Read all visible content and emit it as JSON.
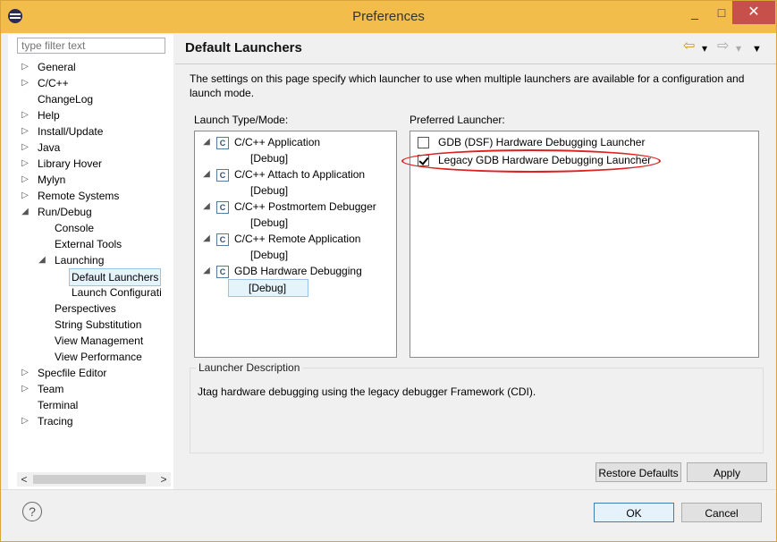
{
  "window": {
    "title": "Preferences",
    "min_label": "_",
    "max_label": "□",
    "close_label": "✕"
  },
  "left": {
    "filter_placeholder": "type filter text",
    "tree": [
      {
        "label": "General",
        "indent": 0,
        "twisty": "▷"
      },
      {
        "label": "C/C++",
        "indent": 0,
        "twisty": "▷"
      },
      {
        "label": "ChangeLog",
        "indent": 0,
        "twisty": ""
      },
      {
        "label": "Help",
        "indent": 0,
        "twisty": "▷"
      },
      {
        "label": "Install/Update",
        "indent": 0,
        "twisty": "▷"
      },
      {
        "label": "Java",
        "indent": 0,
        "twisty": "▷"
      },
      {
        "label": "Library Hover",
        "indent": 0,
        "twisty": "▷"
      },
      {
        "label": "Mylyn",
        "indent": 0,
        "twisty": "▷"
      },
      {
        "label": "Remote Systems",
        "indent": 0,
        "twisty": "▷"
      },
      {
        "label": "Run/Debug",
        "indent": 0,
        "twisty": "◢"
      },
      {
        "label": "Console",
        "indent": 1,
        "twisty": ""
      },
      {
        "label": "External Tools",
        "indent": 1,
        "twisty": ""
      },
      {
        "label": "Launching",
        "indent": 1,
        "twisty": "◢"
      },
      {
        "label": "Default Launchers",
        "indent": 2,
        "twisty": "",
        "selected": true
      },
      {
        "label": "Launch Configurati",
        "indent": 2,
        "twisty": ""
      },
      {
        "label": "Perspectives",
        "indent": 1,
        "twisty": ""
      },
      {
        "label": "String Substitution",
        "indent": 1,
        "twisty": ""
      },
      {
        "label": "View Management",
        "indent": 1,
        "twisty": ""
      },
      {
        "label": "View Performance",
        "indent": 1,
        "twisty": ""
      },
      {
        "label": "Specfile Editor",
        "indent": 0,
        "twisty": "▷"
      },
      {
        "label": "Team",
        "indent": 0,
        "twisty": "▷"
      },
      {
        "label": "Terminal",
        "indent": 0,
        "twisty": ""
      },
      {
        "label": "Tracing",
        "indent": 0,
        "twisty": "▷"
      }
    ]
  },
  "page": {
    "title": "Default Launchers",
    "description": "The settings on this page specify which launcher to use when multiple launchers are available for a configuration and launch mode.",
    "launch_type_label": "Launch Type/Mode:",
    "launch_types": [
      {
        "name": "C/C++ Application",
        "mode": "[Debug]"
      },
      {
        "name": "C/C++ Attach to Application",
        "mode": "[Debug]"
      },
      {
        "name": "C/C++ Postmortem Debugger",
        "mode": "[Debug]"
      },
      {
        "name": "C/C++ Remote Application",
        "mode": "[Debug]"
      },
      {
        "name": "GDB Hardware Debugging",
        "mode": "[Debug]",
        "mode_selected": true
      }
    ],
    "preferred_label": "Preferred Launcher:",
    "launchers": [
      {
        "name": "GDB (DSF) Hardware Debugging Launcher",
        "checked": false
      },
      {
        "name": "Legacy GDB Hardware Debugging Launcher",
        "checked": true
      }
    ],
    "desc_group_title": "Launcher Description",
    "desc_text": "Jtag hardware debugging using the legacy debugger Framework (CDI).",
    "restore_defaults": "Restore Defaults",
    "apply": "Apply"
  },
  "footer": {
    "help": "?",
    "ok": "OK",
    "cancel": "Cancel"
  },
  "icons": {
    "back": "⇦",
    "forward": "⇨",
    "dropdown": "▾",
    "menu": "▼",
    "launch": "C",
    "scroll_left": "<",
    "scroll_right": ">"
  },
  "colors": {
    "titlebar": "#f3bd4c",
    "close": "#c7504a",
    "annotation": "#dd2222"
  }
}
